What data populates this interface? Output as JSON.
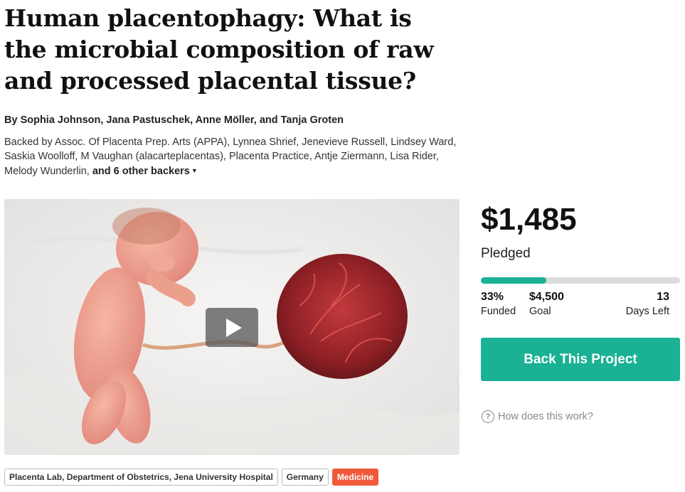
{
  "project": {
    "title": "Human placentophagy: What is the microbial composition of raw and processed placental tissue?",
    "authors": "By Sophia Johnson, Jana Pastuschek, Anne Möller, and Tanja Groten",
    "backers_text": "Backed by Assoc. Of Placenta Prep. Arts (APPA), Lynnea Shrief, Jenevieve Russell, Lindsey Ward, Saskia Woolloff, M Vaughan (alacarteplacentas), Placenta Practice, Antje Ziermann, Lisa Rider, Melody Wunderlin,",
    "more_backers": "and 6 other backers",
    "more_icon": "chevron-down-icon"
  },
  "media": {
    "play_icon": "play-icon"
  },
  "funding": {
    "pledged_amount": "$1,485",
    "pledged_label": "Pledged",
    "progress_fraction": 0.33,
    "funded_pct": "33%",
    "funded_label": "Funded",
    "goal_amount": "$4,500",
    "goal_label": "Goal",
    "days_left": "13",
    "days_label": "Days Left",
    "accent_color": "#1ab195"
  },
  "cta": {
    "back_label": "Back This Project"
  },
  "help": {
    "icon": "question-circle-icon",
    "glyph": "?",
    "label": "How does this work?"
  },
  "tags": [
    {
      "label": "Placenta Lab, Department of Obstetrics, Jena University Hospital"
    },
    {
      "label": "Germany"
    },
    {
      "label": "Medicine",
      "color": "#f05a3a"
    }
  ]
}
